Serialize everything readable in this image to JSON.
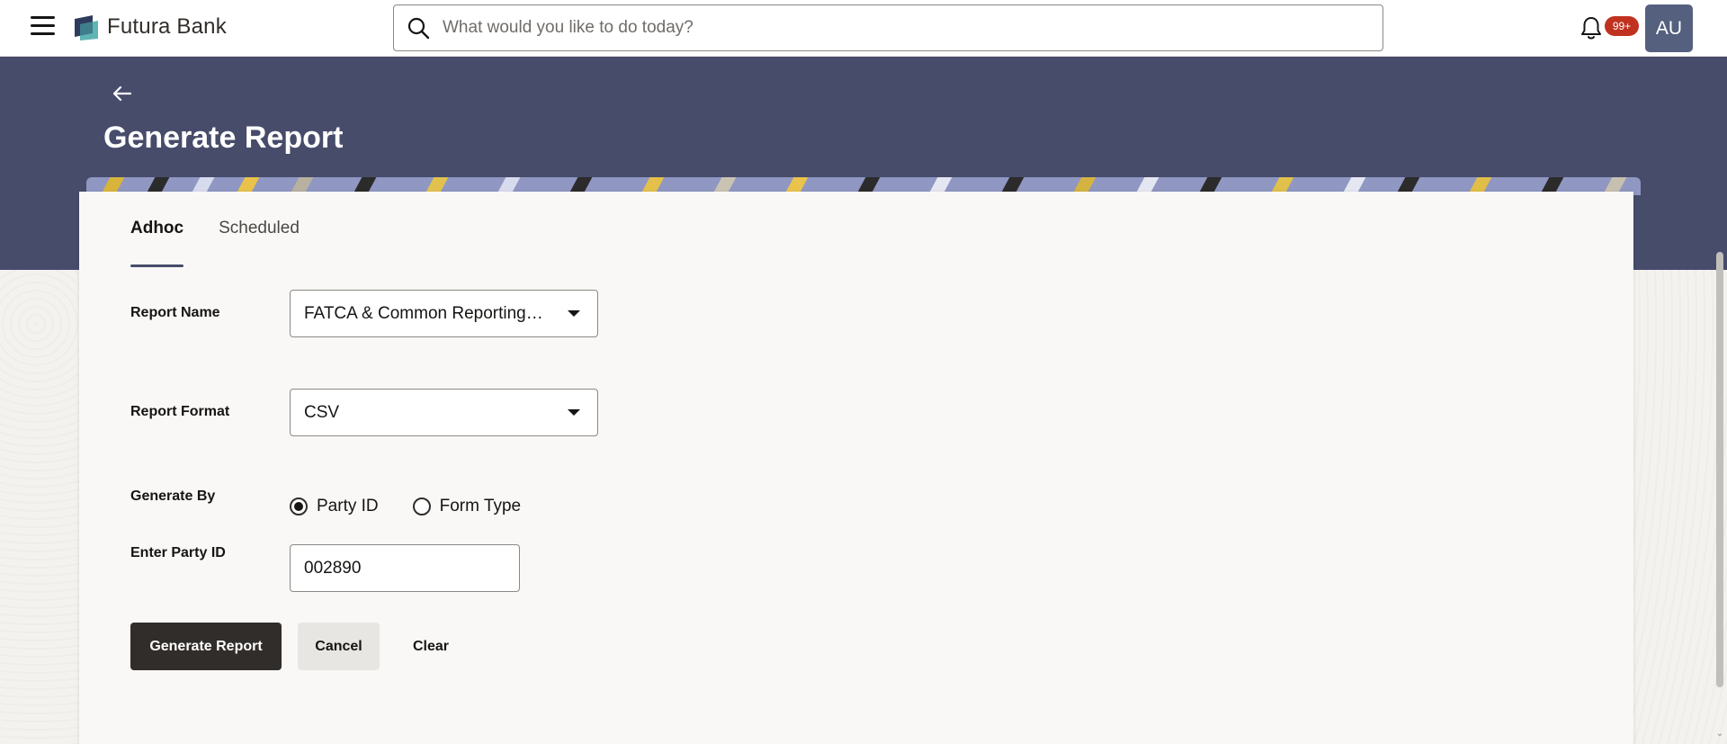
{
  "app": {
    "brand": "Futura Bank",
    "menu_icon": "hamburger-menu-icon",
    "logo_icon": "futura-bank-logo-icon"
  },
  "search": {
    "placeholder": "What would you like to do today?",
    "icon": "search-icon"
  },
  "notifications": {
    "icon": "bell-icon",
    "badge": "99+",
    "badge_color": "#c0321f"
  },
  "user": {
    "initials": "AU",
    "avatar_color": "#55607f"
  },
  "page": {
    "back_icon": "arrow-left-icon",
    "title": "Generate Report",
    "header_color": "#474c6b"
  },
  "tabs": [
    {
      "label": "Adhoc",
      "active": true
    },
    {
      "label": "Scheduled",
      "active": false
    }
  ],
  "form": {
    "report_name": {
      "label": "Report Name",
      "value": "FATCA & Common Reporting Standards"
    },
    "report_format": {
      "label": "Report Format",
      "value": "CSV"
    },
    "generate_by": {
      "label": "Generate By",
      "options": [
        {
          "label": "Party ID",
          "selected": true
        },
        {
          "label": "Form Type",
          "selected": false
        }
      ]
    },
    "party_id": {
      "label": "Enter Party ID",
      "value": "002890"
    }
  },
  "actions": {
    "generate": "Generate Report",
    "cancel": "Cancel",
    "clear": "Clear"
  }
}
